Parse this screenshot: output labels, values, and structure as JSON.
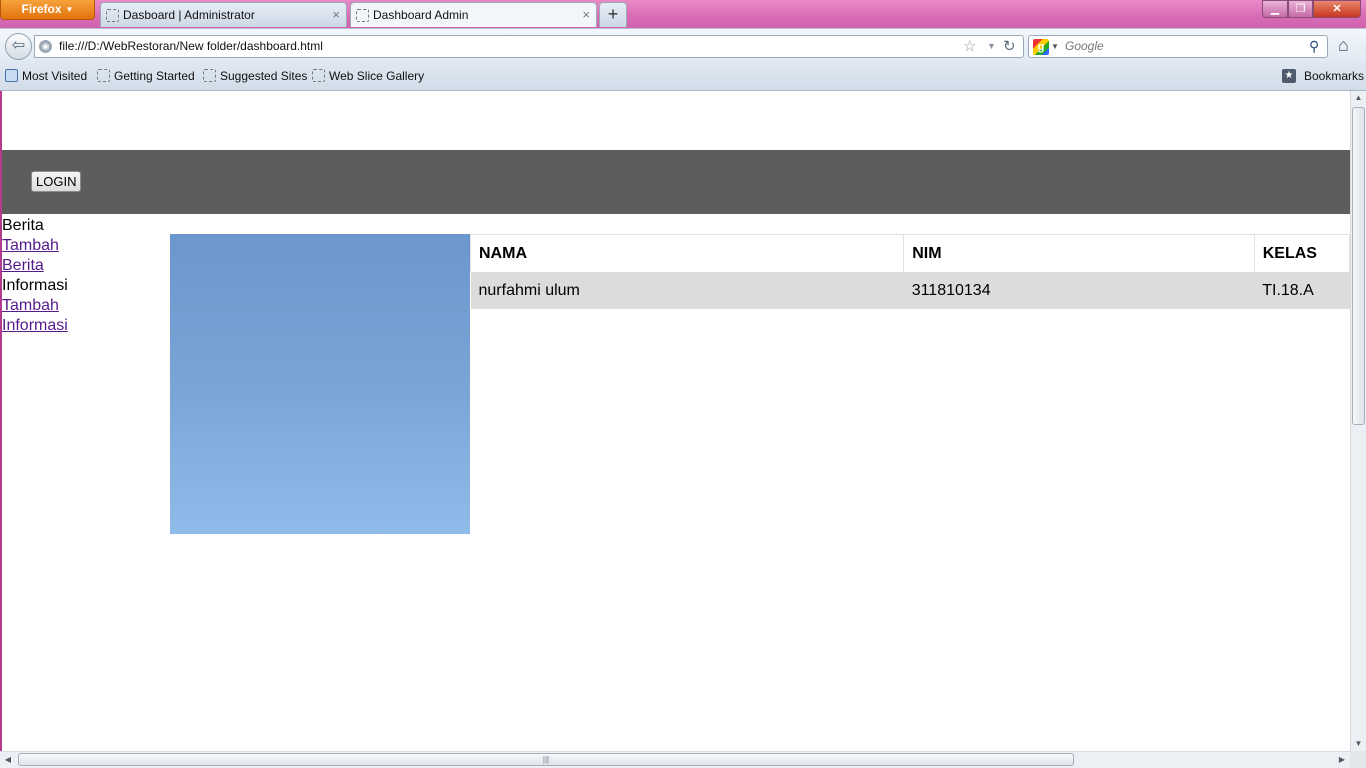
{
  "browser": {
    "menu_button": "Firefox",
    "tabs": [
      {
        "title": "Dasboard | Administrator",
        "active": false
      },
      {
        "title": "Dashboard Admin",
        "active": true
      }
    ],
    "new_tab": "+",
    "url": "file:///D:/WebRestoran/New folder/dashboard.html",
    "search_placeholder": "Google",
    "bookmarks": [
      "Most Visited",
      "Getting Started",
      "Suggested Sites",
      "Web Slice Gallery"
    ],
    "bookmarks_menu": "Bookmarks"
  },
  "page": {
    "login_button": "LOGIN",
    "sidebar": {
      "heading_berita": "Berita",
      "link_tambah_berita_1": "Tambah",
      "link_tambah_berita_2": "Berita",
      "heading_informasi": "Informasi",
      "link_tambah_info_1": "Tambah",
      "link_tambah_info_2": "Informasi"
    },
    "table": {
      "headers": [
        "NAMA",
        "NIM",
        "KELAS"
      ],
      "rows": [
        [
          "nurfahmi ulum",
          "311810134",
          "TI.18.A"
        ]
      ]
    }
  },
  "colors": {
    "header_band": "#5d5d5d",
    "row_bg": "#dcdcdc",
    "visited_link": "#551a8b",
    "photo_sky": "#7aa4d6"
  },
  "icons": {
    "back": "back-arrow-icon",
    "home": "home-icon",
    "reload": "reload-icon",
    "bookmark_star": "star-icon",
    "search": "magnifier-icon"
  }
}
